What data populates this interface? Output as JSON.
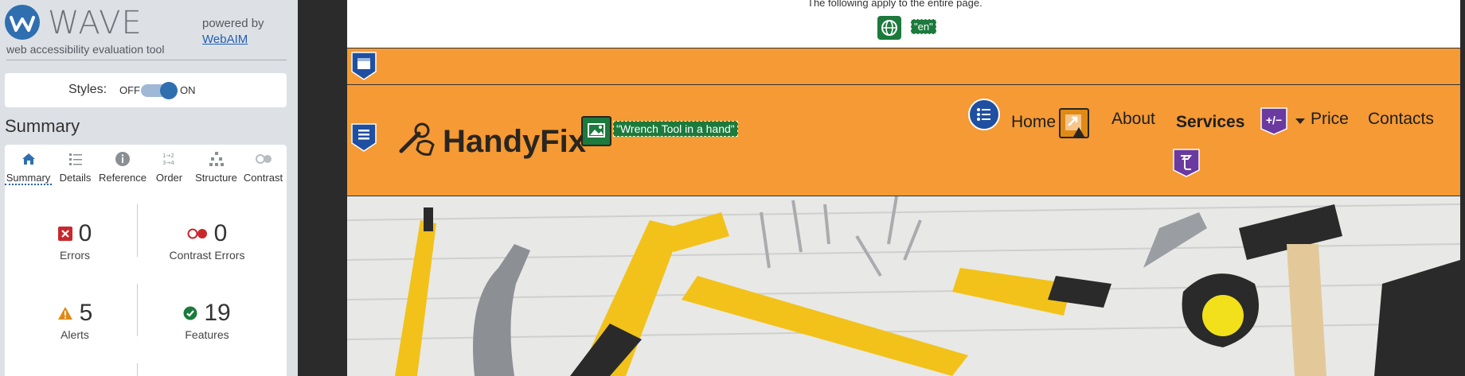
{
  "wave": {
    "title": "WAVE",
    "subtitle": "web accessibility evaluation tool",
    "powered_by": "powered by",
    "webaim_link": "WebAIM",
    "styles_label": "Styles:",
    "styles_off": "OFF",
    "styles_on": "ON",
    "summary_heading": "Summary",
    "tabs": [
      {
        "label": "Summary",
        "icon": "home-icon"
      },
      {
        "label": "Details",
        "icon": "list-icon"
      },
      {
        "label": "Reference",
        "icon": "info-icon"
      },
      {
        "label": "Order",
        "icon": "order-icon"
      },
      {
        "label": "Structure",
        "icon": "structure-icon"
      },
      {
        "label": "Contrast",
        "icon": "contrast-icon"
      }
    ],
    "stats": {
      "errors": {
        "count": "0",
        "label": "Errors",
        "color": "#c8282c"
      },
      "contrast": {
        "count": "0",
        "label": "Contrast Errors",
        "color": "#c8282c"
      },
      "alerts": {
        "count": "5",
        "label": "Alerts",
        "color": "#e08a16"
      },
      "features": {
        "count": "19",
        "label": "Features",
        "color": "#1c7a3c"
      }
    }
  },
  "page": {
    "top_text": "The following apply to the entire page.",
    "lang_tag": "\"en\"",
    "brand": "HandyFix",
    "logo_alt": "\"Wrench Tool in a hand\"",
    "nav": {
      "home": "Home",
      "about": "About",
      "services": "Services",
      "price": "Price",
      "contacts": "Contacts",
      "expand_badge": "+/−"
    },
    "colors": {
      "header_bg": "#f59a34",
      "feature_green": "#1c7a3c",
      "structure_blue": "#1f4fa0",
      "aria_purple": "#6a3aa0"
    }
  }
}
